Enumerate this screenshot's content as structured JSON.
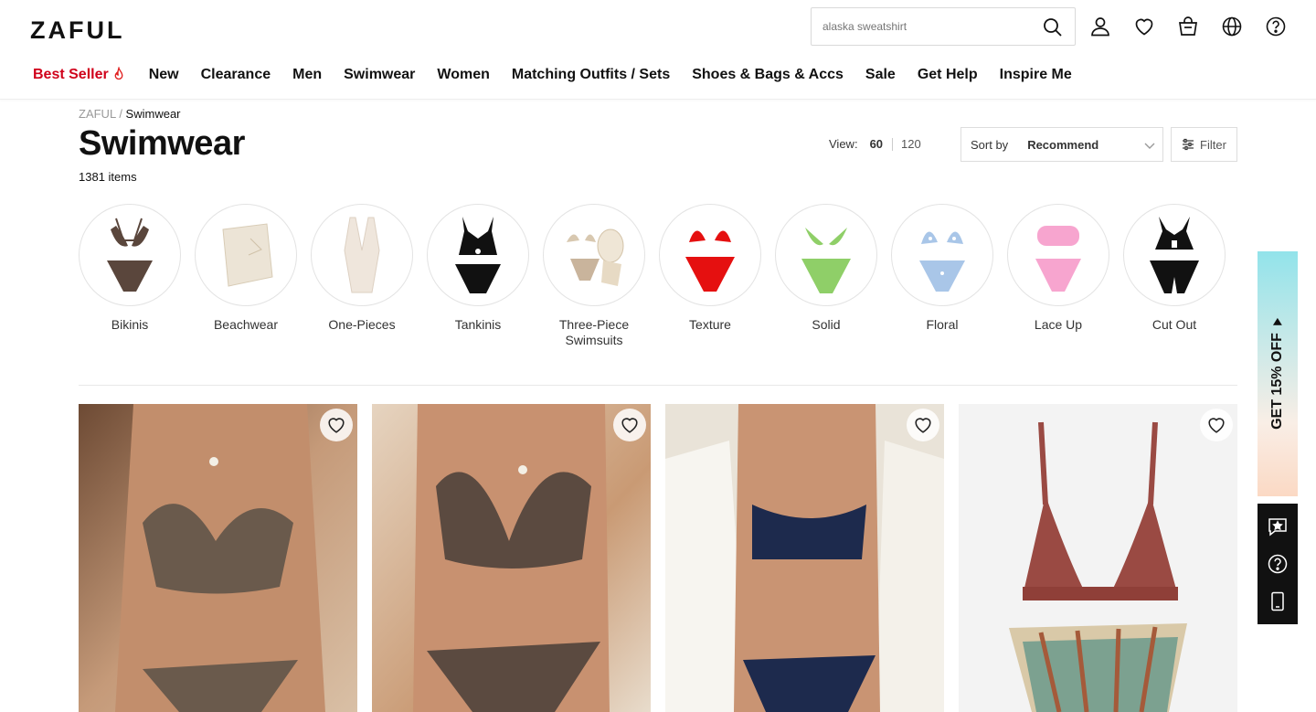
{
  "header": {
    "logo": "ZAFUL",
    "search_placeholder": "alaska sweatshirt",
    "nav": [
      {
        "label": "Best Seller",
        "hot": true
      },
      {
        "label": "New"
      },
      {
        "label": "Clearance"
      },
      {
        "label": "Men"
      },
      {
        "label": "Swimwear"
      },
      {
        "label": "Women"
      },
      {
        "label": "Matching Outfits / Sets"
      },
      {
        "label": "Shoes & Bags & Accs"
      },
      {
        "label": "Sale"
      },
      {
        "label": "Get Help"
      },
      {
        "label": "Inspire Me"
      }
    ]
  },
  "breadcrumb": {
    "root": "ZAFUL",
    "sep": " / ",
    "current": "Swimwear"
  },
  "page": {
    "title": "Swimwear",
    "count": "1381 items"
  },
  "view": {
    "label": "View:",
    "options": [
      "60",
      "120"
    ],
    "active": "60"
  },
  "sort": {
    "label": "Sort by",
    "value": "Recommend"
  },
  "filter": {
    "label": "Filter"
  },
  "categories": [
    {
      "label": "Bikinis",
      "color": "#5a463c"
    },
    {
      "label": "Beachwear",
      "color": "#ece4d6"
    },
    {
      "label": "One-Pieces",
      "color": "#efe6dc"
    },
    {
      "label": "Tankinis",
      "color": "#111111"
    },
    {
      "label": "Three-Piece Swimsuits",
      "color": "#c9b49c"
    },
    {
      "label": "Texture",
      "color": "#e51010"
    },
    {
      "label": "Solid",
      "color": "#8fcf68"
    },
    {
      "label": "Floral",
      "color": "#a9c6e8"
    },
    {
      "label": "Lace Up",
      "color": "#f7a5cf"
    },
    {
      "label": "Cut Out",
      "color": "#111111"
    }
  ],
  "products": [
    {
      "name": "brown-textured-bikini",
      "bg": "#a27f67",
      "suit": "#6a5a4c"
    },
    {
      "name": "brown-ribbed-bikini",
      "bg": "#c7a484",
      "suit": "#5b4a40"
    },
    {
      "name": "navy-ribbed-bikini",
      "bg": "#c89d82",
      "suit": "#1d2a4d"
    },
    {
      "name": "rust-floral-bikini-set",
      "bg": "#f2f2f2",
      "suit": "#9a4a43"
    }
  ],
  "promo": {
    "label": "GET 15% OFF"
  }
}
